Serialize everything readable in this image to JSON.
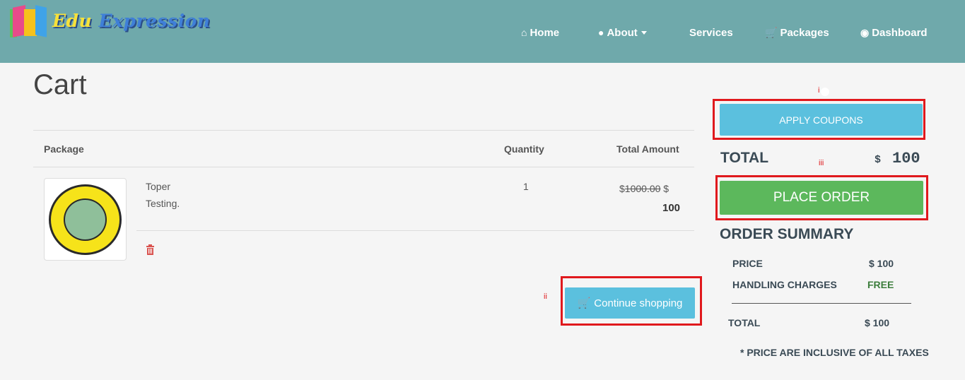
{
  "brand": {
    "word1": "Edu",
    "word2": "Expression"
  },
  "nav": {
    "home": "Home",
    "about": "About",
    "services": "Services",
    "packages": "Packages",
    "dashboard": "Dashboard"
  },
  "page": {
    "title": "Cart"
  },
  "table": {
    "headers": {
      "package": "Package",
      "quantity": "Quantity",
      "total_amount": "Total Amount"
    },
    "rows": [
      {
        "name_line1": "Toper",
        "name_line2": "Testing.",
        "quantity": "1",
        "currency": "$",
        "old_price": "1000.00",
        "currency2": "$",
        "new_price": "100"
      }
    ]
  },
  "buttons": {
    "continue_shopping": "Continue shopping",
    "apply_coupons": "APPLY COUPONS",
    "place_order": "PLACE ORDER"
  },
  "markers": {
    "i": "i",
    "ii": "ii",
    "iii": "iii"
  },
  "summary": {
    "total_label": "TOTAL",
    "total_currency": "$",
    "total_value": "100",
    "order_summary_title": "ORDER SUMMARY",
    "price_label": "PRICE",
    "price_value": "$ 100",
    "handling_label": "HANDLING CHARGES",
    "handling_value": "FREE",
    "final_total_label": "TOTAL",
    "final_total_value": "$ 100",
    "note": "* PRICE ARE INCLUSIVE OF ALL TAXES"
  },
  "colors": {
    "navbar": "#6fa9ab",
    "info": "#5bc0de",
    "success": "#5cb85c",
    "annotation": "#e0191d"
  }
}
